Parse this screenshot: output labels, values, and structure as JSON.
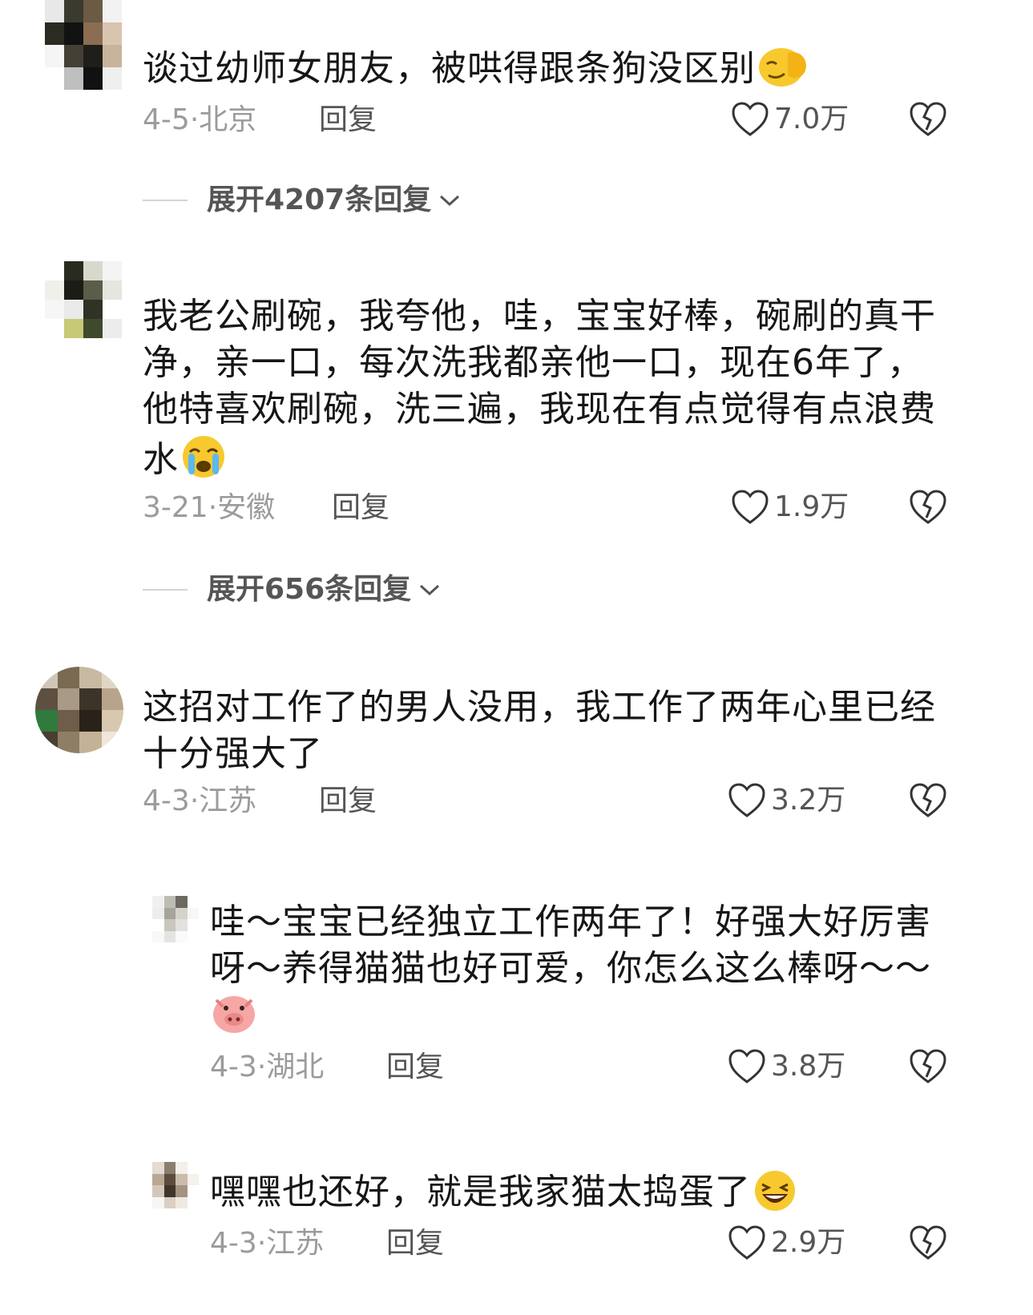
{
  "comments": [
    {
      "text": "谈过幼师女朋友，被哄得跟条狗没区别",
      "emoji": "smug-face-emoji",
      "date": "4-5",
      "location": "北京",
      "reply_label": "回复",
      "likes": "7.0万",
      "expand_label": "展开4207条回复"
    },
    {
      "text": "我老公刷碗，我夸他，哇，宝宝好棒，碗刷的真干净，亲一口，每次洗我都亲他一口，现在6年了，他特喜欢刷碗，洗三遍，我现在有点觉得有点浪费水",
      "emoji": "crying-face-emoji",
      "date": "3-21",
      "location": "安徽",
      "reply_label": "回复",
      "likes": "1.9万",
      "expand_label": "展开656条回复"
    },
    {
      "text": "这招对工作了的男人没用，我工作了两年心里已经十分强大了",
      "date": "4-3",
      "location": "江苏",
      "reply_label": "回复",
      "likes": "3.2万"
    }
  ],
  "replies": [
    {
      "text": "哇～宝宝已经独立工作两年了！好强大好厉害呀～养得猫猫也好可爱，你怎么这么棒呀～～",
      "emoji": "pig-face-emoji",
      "date": "4-3",
      "location": "湖北",
      "reply_label": "回复",
      "likes": "3.8万"
    },
    {
      "text": "嘿嘿也还好，就是我家猫太捣蛋了",
      "emoji": "grinning-face-emoji",
      "date": "4-3",
      "location": "江苏",
      "reply_label": "回复",
      "likes": "2.9万"
    }
  ],
  "colors": {
    "text": "#161616",
    "meta": "#9b9b9b",
    "action": "#555555",
    "divider": "#d4d4d4"
  },
  "icons": [
    "heart-outline-icon",
    "broken-heart-icon",
    "chevron-down-icon"
  ]
}
